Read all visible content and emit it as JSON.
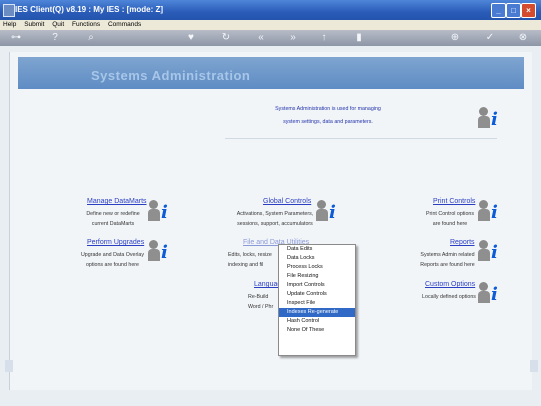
{
  "window": {
    "title": "IES Client(Q) v8.19 : My IES :        [mode: Z]",
    "buttons": [
      "minimize",
      "maximize",
      "close"
    ]
  },
  "menu": [
    "Help",
    "Submit",
    "Quit",
    "Functions",
    "Commands"
  ],
  "toolbar": {
    "icons": [
      "key-icon",
      "help-icon",
      "search-icon",
      "heart-icon",
      "refresh-icon",
      "back-icon",
      "forward-icon",
      "upload-icon",
      "cut-icon",
      "plus-icon",
      "confirm-icon",
      "close-icon"
    ]
  },
  "page": {
    "title": "Systems Administration",
    "intro": [
      "Systems Administration is used for managing",
      "system settings, data and parameters."
    ]
  },
  "sections": [
    {
      "key": "manage",
      "title": "Manage DataMarts",
      "lines": [
        "Define new or redefine",
        "current DataMarts"
      ]
    },
    {
      "key": "global",
      "title": "Global Controls",
      "lines": [
        "Activations, System Parameters,",
        "sessions, support, accumulators"
      ]
    },
    {
      "key": "print",
      "title": "Print Controls",
      "lines": [
        "Print Control options",
        "are found here"
      ]
    },
    {
      "key": "upgrades",
      "title": "Perform Upgrades",
      "lines": [
        "Upgrade and Data Overlay",
        "options are found here"
      ]
    },
    {
      "key": "file",
      "title": "File and Data Utilities",
      "lines": [
        "Edits, locks, resize",
        "indexing and fil"
      ]
    },
    {
      "key": "reports",
      "title": "Reports",
      "lines": [
        "Systems Admin related",
        "Reports are found here"
      ]
    },
    {
      "key": "language",
      "title": "Languag",
      "lines": [
        "Re-Build",
        "Word / Phr"
      ]
    },
    {
      "key": "custom",
      "title": "Custom Options",
      "lines": [
        "Locally defined options"
      ]
    }
  ],
  "dropdown": {
    "selected": "Indexes Re-generate",
    "items": [
      "Data Edits",
      "Data Locks",
      "Process Locks",
      "File Resizing",
      "Import Controls",
      "Update Controls",
      "Inspect File",
      "Indexes Re-generate",
      "Hash Control",
      "None Of These"
    ]
  },
  "colors": {
    "accent": "#3169c6",
    "link": "#2b3fc2",
    "banner": "#6f97c9"
  }
}
